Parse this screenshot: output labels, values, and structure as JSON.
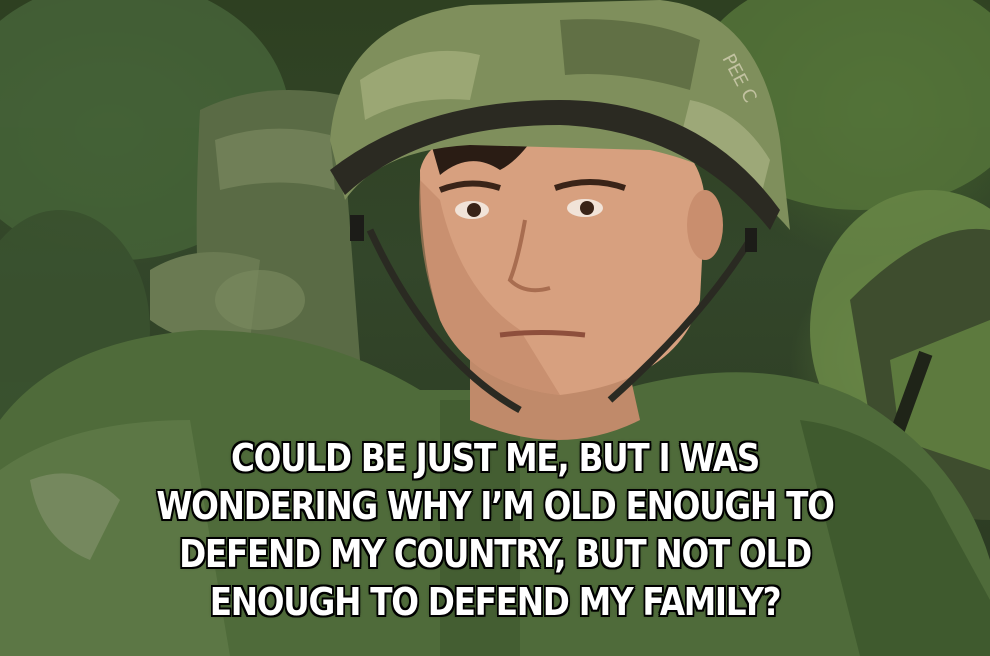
{
  "meme": {
    "caption_lines": [
      "COULD BE JUST ME, BUT I WAS",
      "WONDERING WHY I’M OLD ENOUGH TO",
      "DEFEND MY COUNTRY, BUT NOT OLD",
      "ENOUGH TO DEFEND MY FAMILY?"
    ],
    "helmet_text": "PEE C"
  },
  "colors": {
    "caption_fill": "#ffffff",
    "caption_outline": "#000000",
    "foliage": "#3d5a2c",
    "uniform_green": "#4f6b3a",
    "helmet_camo": "#7f8f5c"
  }
}
